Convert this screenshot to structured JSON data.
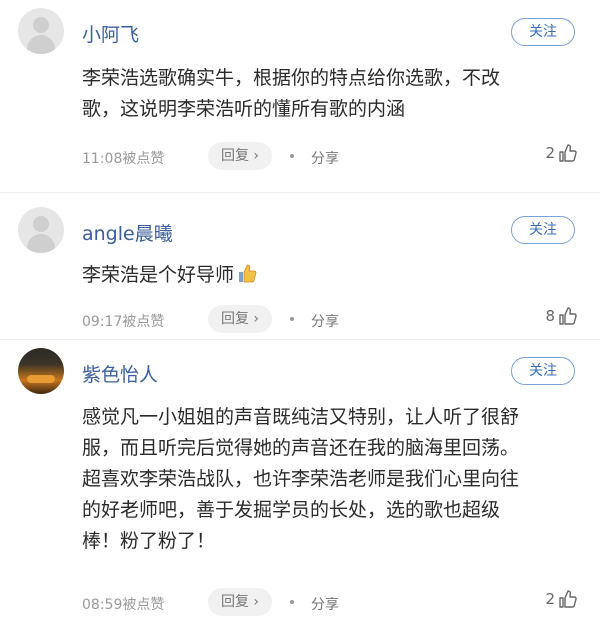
{
  "comments": [
    {
      "username": "小阿飞",
      "follow_label": "关注",
      "text_lines": [
        "李荣浩选歌确实牛，根据你的特点给你选歌，不改",
        "歌，这说明李荣浩听的懂所有歌的内涵"
      ],
      "time_label": "11:08被点赞",
      "reply_label": "回复",
      "share_label": "分享",
      "likes": "2",
      "avatar": "default-avatar"
    },
    {
      "username": "angle晨曦",
      "follow_label": "关注",
      "text_lines": [
        "李荣浩是个好导师"
      ],
      "time_label": "09:17被点赞",
      "reply_label": "回复",
      "share_label": "分享",
      "likes": "8",
      "avatar": "default-avatar",
      "emoji": "thumbs-up-emoji"
    },
    {
      "username": "紫色怡人",
      "follow_label": "关注",
      "text_lines": [
        "感觉凡一小姐姐的声音既纯洁又特别，让人听了很舒",
        "服，而且听完后觉得她的声音还在我的脑海里回荡。",
        "超喜欢李荣浩战队，也许李荣浩老师是我们心里向往",
        "的好老师吧，善于发掘学员的长处，选的歌也超级",
        "棒！粉了粉了！"
      ],
      "time_label": "08:59被点赞",
      "reply_label": "回复",
      "share_label": "分享",
      "likes": "2",
      "avatar": "photo-avatar"
    }
  ],
  "icons": {
    "like": "thumbs-up-icon",
    "reply_chevron": "chevron-right-icon"
  },
  "colors": {
    "username": "#3a5f9a",
    "follow_border": "#7aa1d6",
    "meta": "#9a9a9a"
  }
}
